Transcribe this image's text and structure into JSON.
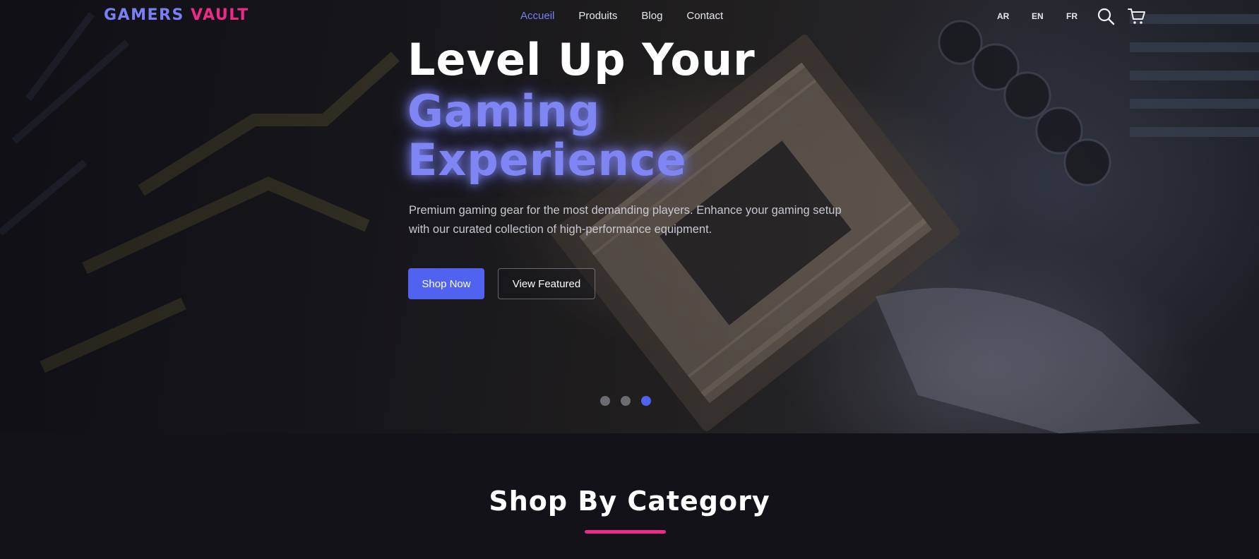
{
  "brand": {
    "part1": "GAMERS",
    "part2": "VAULT"
  },
  "nav": {
    "items": [
      {
        "label": "Accueil",
        "active": true
      },
      {
        "label": "Produits"
      },
      {
        "label": "Blog"
      },
      {
        "label": "Contact"
      }
    ],
    "languages": [
      "AR",
      "EN",
      "FR"
    ],
    "icons": [
      "search-icon",
      "cart-icon"
    ]
  },
  "hero": {
    "title_line1": "Level Up Your",
    "title_line2": "Gaming",
    "title_line3": "Experience",
    "description": "Premium gaming gear for the most demanding players. Enhance your gaming setup with our curated collection of high-performance equipment.",
    "primary_button": "Shop Now",
    "secondary_button": "View Featured",
    "slides": {
      "count": 3,
      "active_index": 2
    }
  },
  "category_section": {
    "title": "Shop By Category"
  },
  "colors": {
    "accent": "#4f63f0",
    "brand_blue": "#7b7ff6",
    "brand_pink": "#ee2a86",
    "background": "#121218"
  }
}
